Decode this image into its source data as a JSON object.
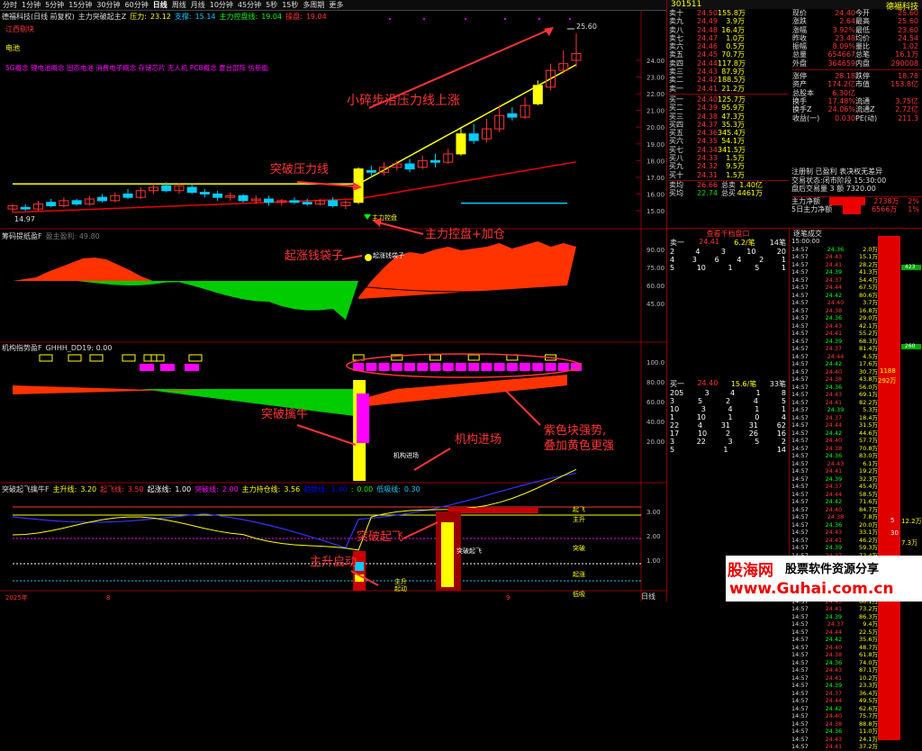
{
  "menu": {
    "items": [
      "分时",
      "1分钟",
      "5分钟",
      "15分钟",
      "30分钟",
      "60分钟",
      "日线",
      "周线",
      "月线",
      "10分钟",
      "45分钟",
      "5秒",
      "15秒",
      "多周期",
      "更多"
    ],
    "active": "日线",
    "right": [
      "复权",
      "叠加",
      "多股",
      "统计",
      "画线",
      "F10",
      "+自选",
      "返回"
    ]
  },
  "main": {
    "stock_label": "德福科技(日线 前复权)",
    "indicator": "主力突破起主Z",
    "pressure_label": "压力:",
    "pressure": "23.12",
    "support_label": "支撑:",
    "support": "15.14",
    "control_label": "主力控盘线:",
    "control": "19.04",
    "stop_label": "操盘:",
    "stop": "19.04",
    "tag1": "江西剔块",
    "tag2": "电池",
    "concepts": "5G概念 锂电池概念 固态电池 消费电子概念 存储芯片 无人机 PCB概念 夏台部阵 仿新能",
    "price_high": "25.60",
    "price_low": "14.97",
    "annot1": "小碎步沿压力线上涨",
    "annot2": "突破压力线",
    "annot3": "主力控盘+加仓",
    "signal_label": "主力控盘",
    "yticks": [
      "24.00",
      "23.00",
      "22.00",
      "21.00",
      "20.00",
      "19.00",
      "18.00",
      "17.00",
      "16.00",
      "15.00"
    ]
  },
  "panel2": {
    "title": "筹码提纸盈F",
    "sub": "盈主盈利: 49.80",
    "annot": "起涨钱袋子",
    "signal": "起涨钱袋子",
    "yticks": [
      "90.00",
      "75.00",
      "60.00",
      "45.00"
    ]
  },
  "panel3": {
    "title": "机构指势盈F",
    "sub": "GHHH_DD19: 0.00",
    "annot1": "突破擒牛",
    "annot2": "机构进场",
    "annot3": "紫色块强势,",
    "annot4": "叠加黄色更强",
    "label_inst": "机构进场",
    "yticks": [
      "100.0",
      "80.00",
      "60.00",
      "40.00",
      "20.00"
    ]
  },
  "panel4": {
    "title": "突破起飞擒牛F",
    "items": [
      {
        "k": "主升线:",
        "v": "3.20",
        "c": "#ff0"
      },
      {
        "k": "起飞线:",
        "v": "3.50",
        "c": "#ff3030"
      },
      {
        "k": "起涨线:",
        "v": "1.00",
        "c": "#fff"
      },
      {
        "k": "突破线:",
        "v": "2.00",
        "c": "#f0f"
      },
      {
        "k": "主力持仓线:",
        "v": "3.56",
        "c": "#ff0"
      },
      {
        "k": "趋势线:",
        "v": "1.40",
        "c": "#00f"
      },
      {
        "k": ":",
        "v": "0.00",
        "c": "#0f0"
      },
      {
        "k": "低吸线:",
        "v": "0.30",
        "c": "#0cf"
      }
    ],
    "annot1": "突破起飞",
    "annot2": "主升启动",
    "lbl_qifei": "起飞",
    "lbl_zhusheng": "主升",
    "lbl_tupo": "突破",
    "lbl_qizhang": "起涨",
    "lbl_dixi": "低吸",
    "bar_label": "突破起飞",
    "small1": "主升",
    "small2": "起动",
    "yticks": [
      "3.00",
      "2.00",
      "1.00"
    ],
    "xlabels": [
      "2025年",
      "8",
      "9"
    ]
  },
  "quote": {
    "code": "301511",
    "name": "德福科技",
    "asks": [
      {
        "n": "卖十",
        "p": "24.50",
        "v": "155.8万"
      },
      {
        "n": "卖九",
        "p": "24.49",
        "v": "3.9万"
      },
      {
        "n": "卖八",
        "p": "24.48",
        "v": "16.4万"
      },
      {
        "n": "卖七",
        "p": "24.47",
        "v": "1.0万"
      },
      {
        "n": "卖六",
        "p": "24.46",
        "v": "0.5万"
      },
      {
        "n": "卖五",
        "p": "24.45",
        "v": "70.7万"
      },
      {
        "n": "卖四",
        "p": "24.44",
        "v": "117.8万"
      },
      {
        "n": "卖三",
        "p": "24.43",
        "v": "87.9万"
      },
      {
        "n": "卖二",
        "p": "24.42",
        "v": "188.5万"
      },
      {
        "n": "卖一",
        "p": "24.41",
        "v": "21.2万"
      }
    ],
    "bids": [
      {
        "n": "买一",
        "p": "24.40",
        "v": "125.7万"
      },
      {
        "n": "买二",
        "p": "24.39",
        "v": "95.9万"
      },
      {
        "n": "买三",
        "p": "24.38",
        "v": "47.3万"
      },
      {
        "n": "买四",
        "p": "24.37",
        "v": "35.3万"
      },
      {
        "n": "买五",
        "p": "24.36",
        "v": "345.4万"
      },
      {
        "n": "买六",
        "p": "24.35",
        "v": "54.1万"
      },
      {
        "n": "买七",
        "p": "24.34",
        "v": "341.5万"
      },
      {
        "n": "买八",
        "p": "24.33",
        "v": "1.5万"
      },
      {
        "n": "买九",
        "p": "24.32",
        "v": "9.5万"
      },
      {
        "n": "买十",
        "p": "24.31",
        "v": "1.5万"
      }
    ],
    "avg_s": "26.66",
    "total_s": "1.40亿",
    "avg_b": "22.74",
    "total_b": "4461万",
    "stats": [
      [
        "现价",
        "24.40",
        "今开",
        "25.60"
      ],
      [
        "涨跌",
        "2.64",
        "最高",
        "25.60"
      ],
      [
        "涨幅",
        "3.92%",
        "最低",
        "23.60"
      ],
      [
        "昨收",
        "23.48",
        "均价",
        "24.54"
      ],
      [
        "振幅",
        "8.09%",
        "量比",
        "1.02"
      ],
      [
        "总量",
        "654667",
        "总笔",
        "16.1万"
      ],
      [
        "外盘",
        "364659",
        "内盘",
        "290008"
      ]
    ],
    "stats2": [
      [
        "涨停",
        "28.18",
        "跌停",
        "18.78"
      ],
      [
        "资产",
        "174.2亿",
        "市值",
        "153.8亿"
      ],
      [
        "总股本",
        "6.30亿",
        "",
        ""
      ],
      [
        "换手",
        "17.48%",
        "流通",
        "3.75亿"
      ],
      [
        "换手Z",
        "24.06%",
        "流通Z",
        "2.72亿"
      ],
      [
        "收益(一)",
        "0.030",
        "PE(动)",
        "211.3"
      ]
    ],
    "note1": "注册制 已盈利 表决权无差异",
    "note2": "交易状态:闭市阶段 15:30:00",
    "note3": "盘后交易量 3 额 7320.00",
    "net1_k": "主力净额",
    "net1_v": "2738万",
    "net1_p": "2%",
    "net2_k": "5日主力净额",
    "net2_v": "6566万",
    "net2_p": "1%",
    "orderbook_title": "查看千档盘口",
    "sell1": "卖一",
    "sell1_p": "24.41",
    "sell1_v": "6.2/笔",
    "sell1_c": "14笔",
    "buy1": "买一",
    "buy1_p": "24.40",
    "buy1_v": "15.6/笔",
    "buy1_c": "33笔",
    "tape_title": "逐笔成交",
    "tape_time": "15:00:00",
    "side_val": "423",
    "side_val2": "260",
    "side_val3": "1188",
    "side_val4": "292万",
    "bottom1": "5",
    "bottom2": "12.2万",
    "bottom3": "30",
    "bottom4": "7.3万"
  },
  "watermark": {
    "t1": "股海网",
    "t2": "股票软件资源分享",
    "t3": "www.Guhai.com.cn"
  },
  "footer_tab": "日线"
}
